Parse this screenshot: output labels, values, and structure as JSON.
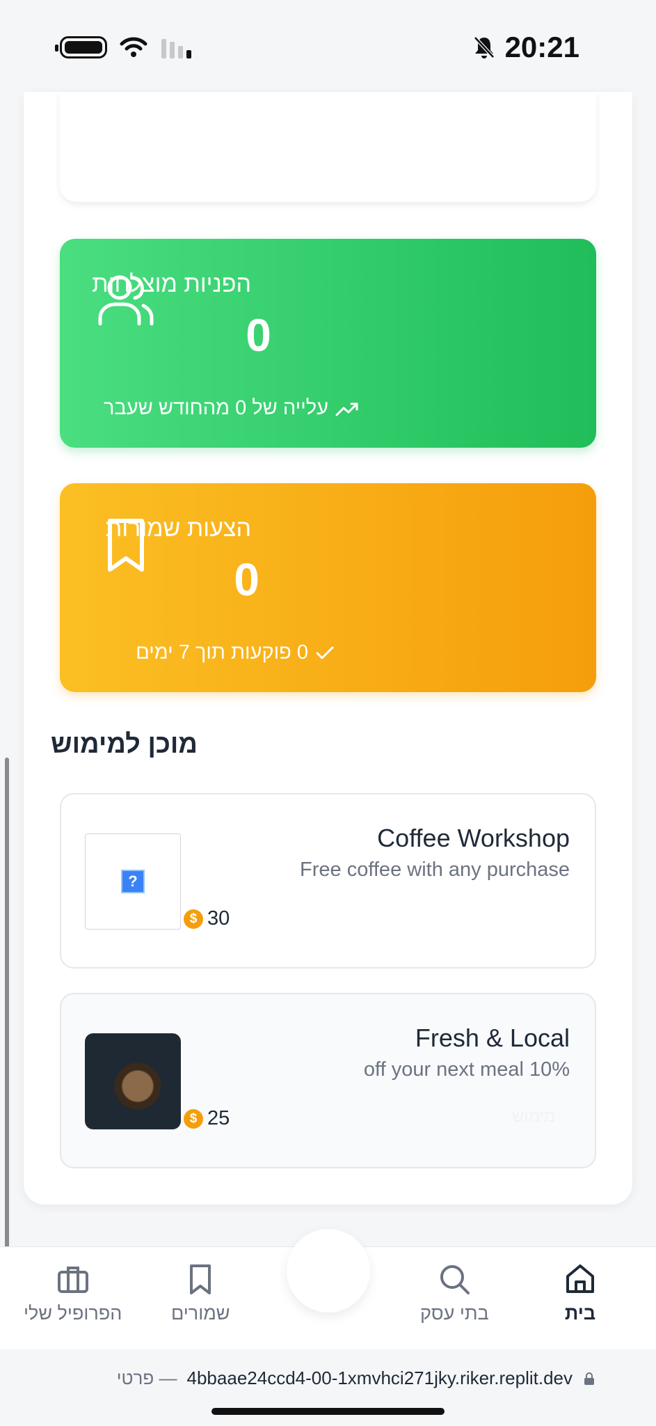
{
  "status_bar": {
    "time": "20:21"
  },
  "stats": [
    {
      "title": "הפניות מוצלחות",
      "value": "0",
      "footnote": "עלייה של 0 מהחודש שעבר",
      "icon": "users-icon",
      "color": "#22c55e"
    },
    {
      "title": "הצעות שמורות",
      "value": "0",
      "footnote": "0 פוקעות תוך 7 ימים",
      "icon": "bookmark-icon",
      "color": "#f59e0b"
    }
  ],
  "ready_section": {
    "title": "מוכן למימוש"
  },
  "offers": [
    {
      "name": "Coffee Workshop",
      "description": "Free coffee with any purchase",
      "points": "30"
    },
    {
      "name": "Fresh & Local",
      "description": "off your next meal 10%",
      "points": "25",
      "faint_label": "מימוש"
    }
  ],
  "nav": {
    "home": "בית",
    "businesses": "בתי עסק",
    "saved": "שמורים",
    "profile": "הפרופיל שלי"
  },
  "browser": {
    "url": "4bbaae24ccd4-00-1xmvhci271jky.riker.replit.dev",
    "label": "פרטי —"
  }
}
